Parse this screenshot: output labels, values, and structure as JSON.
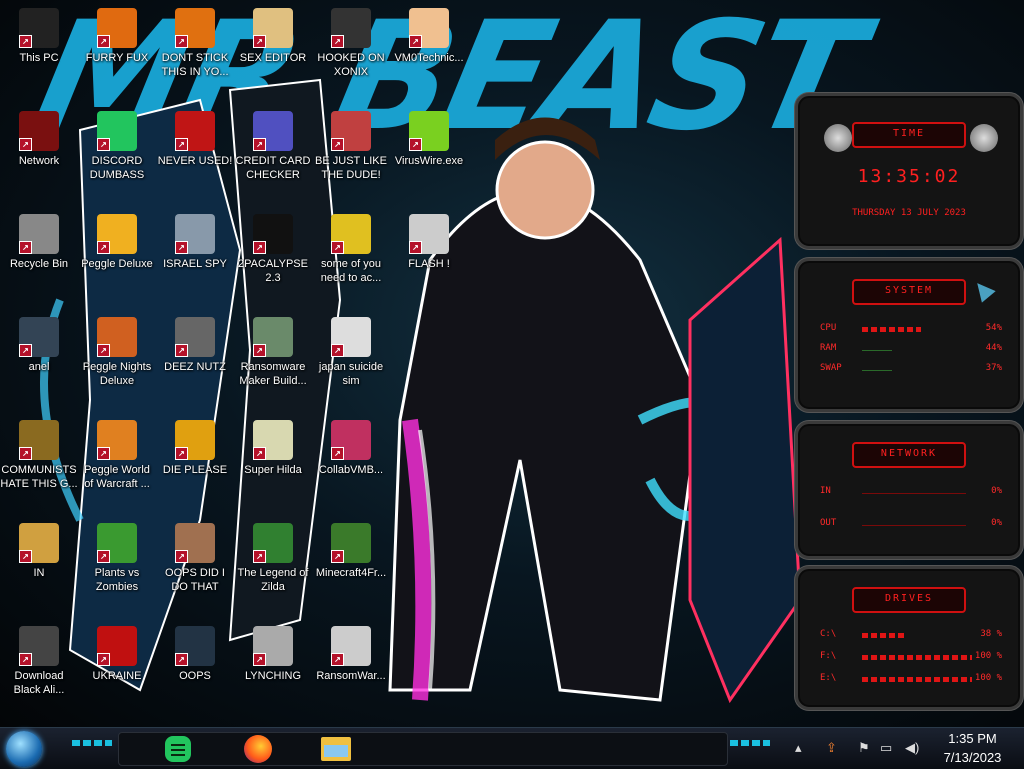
{
  "wallpaper": {
    "title_text": "MR BEAST"
  },
  "desktop_icons": [
    {
      "label": "This PC",
      "icon": "computer-icon",
      "color": "#222222"
    },
    {
      "label": "Network",
      "icon": "network-icon",
      "color": "#7a1010"
    },
    {
      "label": "Recycle Bin",
      "icon": "recycle-bin-icon",
      "color": "#888888"
    },
    {
      "label": "anel",
      "icon": "control-panel-icon",
      "color": "#334455"
    },
    {
      "label": "COMMUNISTS HATE THIS G...",
      "icon": "money-bag-icon",
      "color": "#8a6a20"
    },
    {
      "label": "IN",
      "icon": "cartoon-icon",
      "color": "#d0a040"
    },
    {
      "label": "Download Black Ali...",
      "icon": "alien-icon",
      "color": "#444444"
    },
    {
      "label": "FURRY FUX",
      "icon": "firefox-icon",
      "color": "#e06a10"
    },
    {
      "label": "DISCORD DUMBASS",
      "icon": "chat-icon",
      "color": "#22c55e"
    },
    {
      "label": "Peggle Deluxe",
      "icon": "peggle-icon",
      "color": "#f0b020"
    },
    {
      "label": "Peggle Nights Deluxe",
      "icon": "peggle-icon",
      "color": "#d06020"
    },
    {
      "label": "Peggle World of Warcraft ...",
      "icon": "peggle-icon",
      "color": "#e08020"
    },
    {
      "label": "Plants vs Zombies",
      "icon": "plant-icon",
      "color": "#3a9a30"
    },
    {
      "label": "UKRAINE",
      "icon": "radiation-icon",
      "color": "#c01010"
    },
    {
      "label": "DONT STICK THIS IN YO...",
      "icon": "cone-icon",
      "color": "#e07010"
    },
    {
      "label": "NEVER USED!",
      "icon": "dev-icon",
      "color": "#c01515"
    },
    {
      "label": "ISRAEL SPY",
      "icon": "network-drive-icon",
      "color": "#8899aa"
    },
    {
      "label": "DEEZ NUTZ",
      "icon": "windows-icon",
      "color": "#666666"
    },
    {
      "label": "DIE PLEASE",
      "icon": "de-icon",
      "color": "#e0a010"
    },
    {
      "label": "OOPS DID I DO THAT",
      "icon": "portrait-icon",
      "color": "#a07050"
    },
    {
      "label": "OOPS",
      "icon": "book-icon",
      "color": "#223344"
    },
    {
      "label": "SEX EDITOR",
      "icon": "editor-icon",
      "color": "#e0c080"
    },
    {
      "label": "CREDIT CARD CHECKER",
      "icon": "credit-card-icon",
      "color": "#5050c0"
    },
    {
      "label": "2PACALYPSE 2.3",
      "icon": "terminal-icon",
      "color": "#111111"
    },
    {
      "label": "Ransomware Maker Build...",
      "icon": "window-icon",
      "color": "#6a8a6a"
    },
    {
      "label": "Super Hilda",
      "icon": "pixel-art-icon",
      "color": "#d8d8b0"
    },
    {
      "label": "The Legend of Zilda",
      "icon": "hero-icon",
      "color": "#308030"
    },
    {
      "label": "LYNCHING",
      "icon": "gallows-icon",
      "color": "#aaaaaa"
    },
    {
      "label": "HOOKED ON XONIX",
      "icon": "xonix-icon",
      "color": "#333333"
    },
    {
      "label": "BE JUST LIKE THE DUDE!",
      "icon": "gnome-icon",
      "color": "#c04040"
    },
    {
      "label": "some of you need to ac...",
      "icon": "beaver-icon",
      "color": "#e0c020"
    },
    {
      "label": "japan suicide sim",
      "icon": "document-icon",
      "color": "#dddddd"
    },
    {
      "label": "CollabVMB...",
      "icon": "monitor-icon",
      "color": "#c03060"
    },
    {
      "label": "Minecraft4Fr...",
      "icon": "grass-block-icon",
      "color": "#3a7a2a"
    },
    {
      "label": "RansomWar...",
      "icon": "skull-icon",
      "color": "#cccccc"
    },
    {
      "label": "VM0Technic...",
      "icon": "doctor-icon",
      "color": "#f0c090"
    },
    {
      "label": "VirusWire.exe",
      "icon": "lime-icon",
      "color": "#7ad020"
    },
    {
      "label": "FLASH !",
      "icon": "flash-icon",
      "color": "#cccccc"
    }
  ],
  "widgets": {
    "time": {
      "header": "TIME",
      "clock": "13:35:02",
      "date": "THURSDAY 13 JULY 2023"
    },
    "system": {
      "header": "SYSTEM",
      "rows": [
        {
          "label": "CPU",
          "value": "54%",
          "level": 0.54
        },
        {
          "label": "RAM",
          "value": "44%",
          "level": 0.44
        },
        {
          "label": "SWAP",
          "value": "37%",
          "level": 0.37
        }
      ]
    },
    "network": {
      "header": "NETWORK",
      "rows": [
        {
          "label": "IN",
          "value": "0%"
        },
        {
          "label": "OUT",
          "value": "0%"
        }
      ]
    },
    "drives": {
      "header": "DRIVES",
      "rows": [
        {
          "label": "C:\\",
          "value": "38 %",
          "level": 0.38
        },
        {
          "label": "F:\\",
          "value": "100 %",
          "level": 1.0
        },
        {
          "label": "E:\\",
          "value": "100 %",
          "level": 1.0
        }
      ]
    }
  },
  "taskbar": {
    "pinned": [
      {
        "name": "chat-app",
        "icon": "chat-icon"
      },
      {
        "name": "firefox",
        "icon": "firefox-icon"
      },
      {
        "name": "file-explorer",
        "icon": "folder-icon"
      }
    ],
    "clock_time": "1:35 PM",
    "clock_date": "7/13/2023",
    "tray_icons": [
      "show-hidden-icon",
      "upload-icon",
      "flag-icon",
      "network-icon",
      "volume-icon"
    ]
  }
}
